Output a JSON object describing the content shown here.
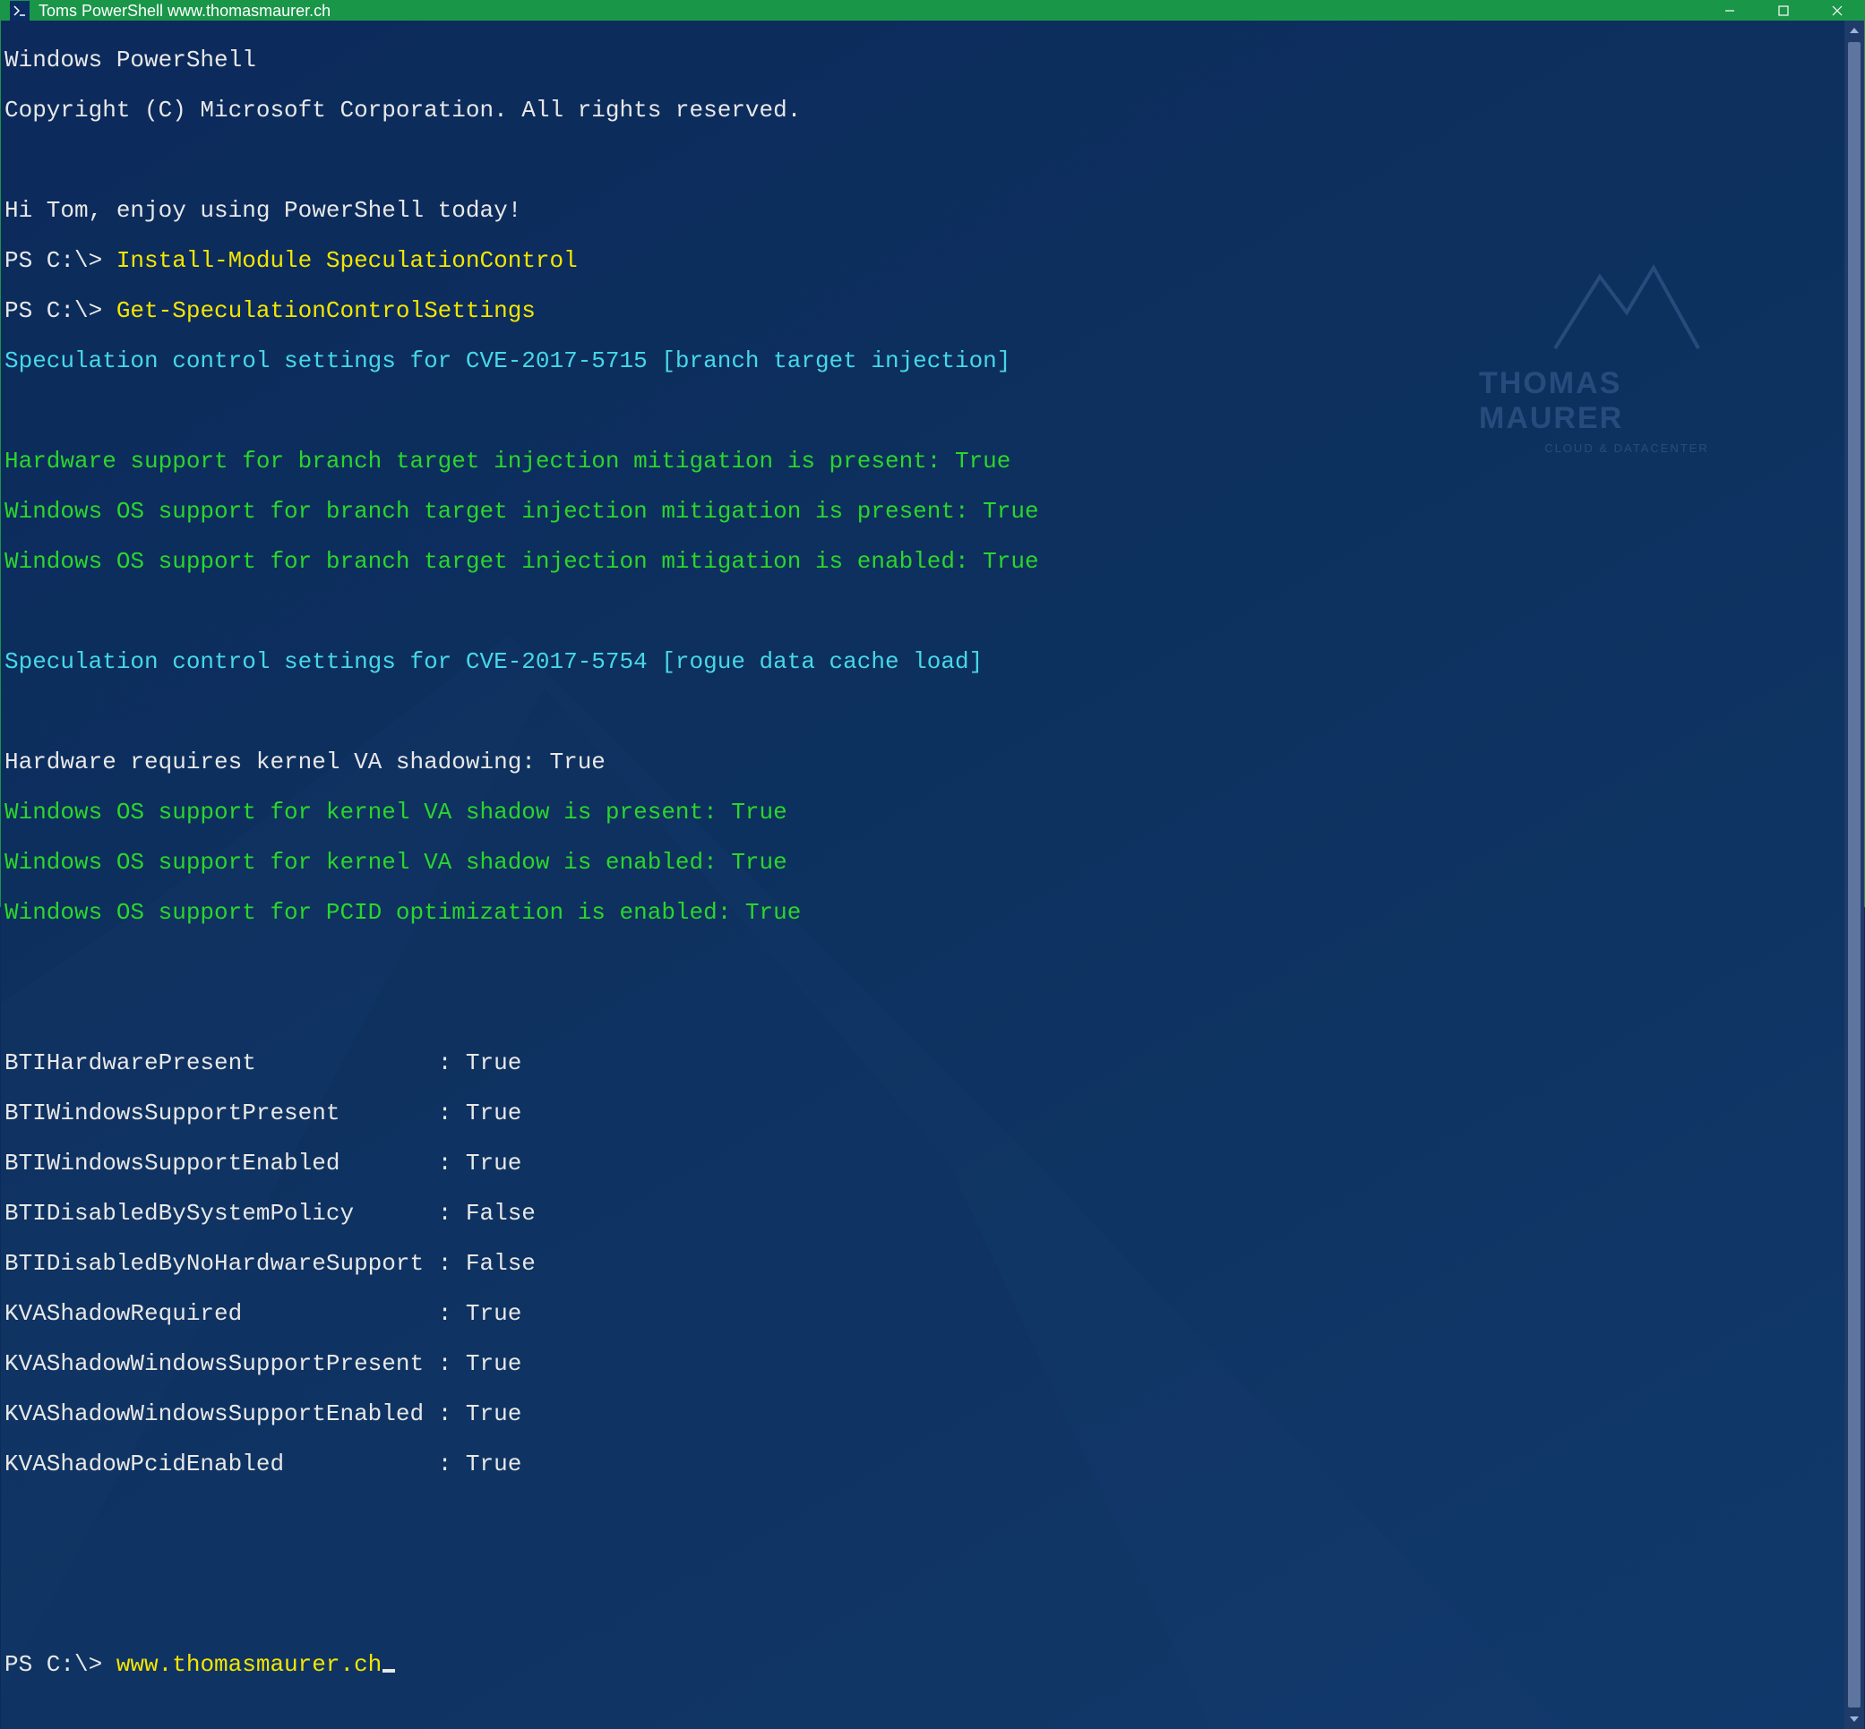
{
  "window": {
    "title": "Toms PowerShell www.thomasmaurer.ch"
  },
  "header": {
    "line1": "Windows PowerShell",
    "line2": "Copyright (C) Microsoft Corporation. All rights reserved."
  },
  "greeting": "Hi Tom, enjoy using PowerShell today!",
  "prompt1": {
    "ps": "PS C:\\> ",
    "cmd": "Install-Module SpeculationControl"
  },
  "prompt2": {
    "ps": "PS C:\\> ",
    "cmd": "Get-SpeculationControlSettings"
  },
  "section1": "Speculation control settings for CVE-2017-5715 [branch target injection]",
  "s1_lines": [
    "Hardware support for branch target injection mitigation is present: True",
    "Windows OS support for branch target injection mitigation is present: True",
    "Windows OS support for branch target injection mitigation is enabled: True"
  ],
  "section2": "Speculation control settings for CVE-2017-5754 [rogue data cache load]",
  "s2_hw": "Hardware requires kernel VA shadowing: True",
  "s2_lines": [
    "Windows OS support for kernel VA shadow is present: True",
    "Windows OS support for kernel VA shadow is enabled: True",
    "Windows OS support for PCID optimization is enabled: True"
  ],
  "table": {
    "rows": [
      {
        "k": "BTIHardwarePresent             ",
        "v": " True"
      },
      {
        "k": "BTIWindowsSupportPresent       ",
        "v": " True"
      },
      {
        "k": "BTIWindowsSupportEnabled       ",
        "v": " True"
      },
      {
        "k": "BTIDisabledBySystemPolicy      ",
        "v": " False"
      },
      {
        "k": "BTIDisabledByNoHardwareSupport ",
        "v": " False"
      },
      {
        "k": "KVAShadowRequired              ",
        "v": " True"
      },
      {
        "k": "KVAShadowWindowsSupportPresent ",
        "v": " True"
      },
      {
        "k": "KVAShadowWindowsSupportEnabled ",
        "v": " True"
      },
      {
        "k": "KVAShadowPcidEnabled           ",
        "v": " True"
      }
    ]
  },
  "prompt3": {
    "ps": "PS C:\\> ",
    "txt": "www.thomasmaurer.ch"
  },
  "watermark": {
    "title": "THOMAS MAURER",
    "sub": "CLOUD & DATACENTER"
  }
}
